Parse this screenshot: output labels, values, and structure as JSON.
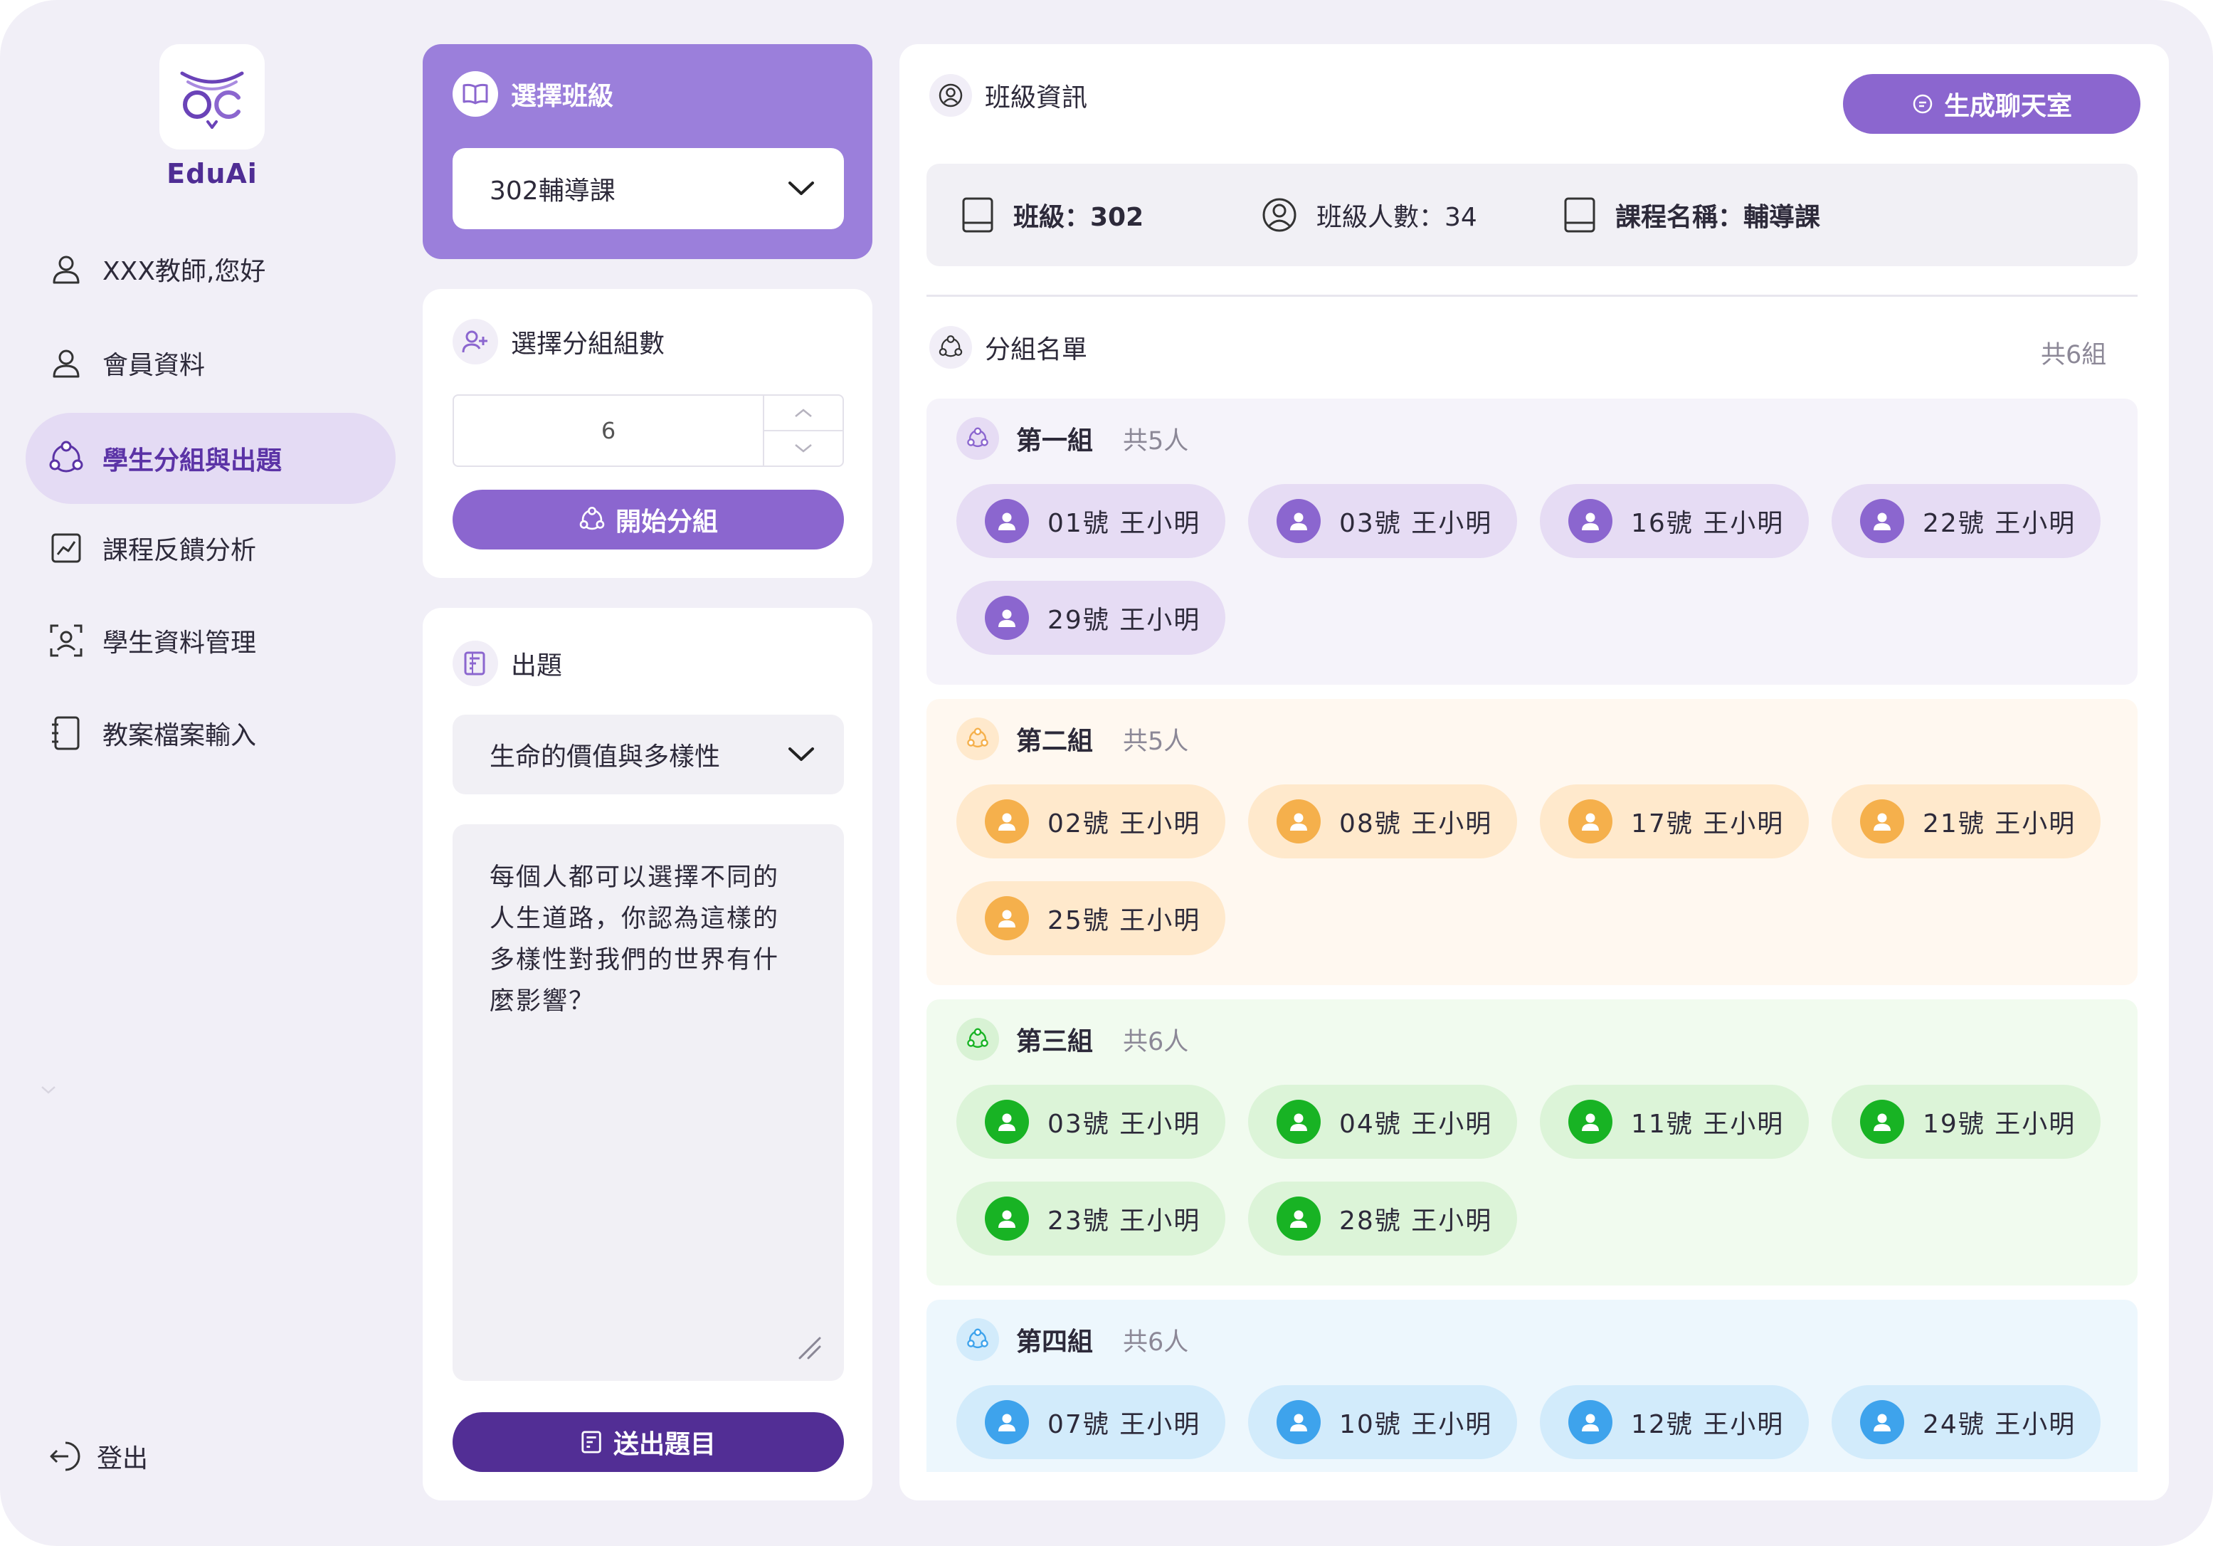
{
  "app": {
    "name": "EduAi"
  },
  "sidebar": {
    "items": [
      {
        "label": "XXX教師,您好"
      },
      {
        "label": "會員資料"
      },
      {
        "label": "學生分組與出題"
      },
      {
        "label": "課程反饋分析"
      },
      {
        "label": "學生資料管理"
      },
      {
        "label": "教案檔案輸入"
      }
    ],
    "logout": "登出"
  },
  "class_select": {
    "title": "選擇班級",
    "value": "302輔導課"
  },
  "group_count": {
    "title": "選擇分組組數",
    "value": "6",
    "button": "開始分組"
  },
  "question": {
    "title": "出題",
    "topic": "生命的價值與多樣性",
    "text_lines": [
      "每個人都可以選擇不同的",
      "人生道路，你認為這樣的",
      "多樣性對我們的世界有什",
      "麼影響？"
    ],
    "submit": "送出題目"
  },
  "class_info": {
    "title": "班級資訊",
    "chat_button": "生成聊天室",
    "class_label": "班級：302",
    "headcount_label": "班級人數：34",
    "course_label": "課程名稱：輔導課"
  },
  "groups_section": {
    "title": "分組名單",
    "total": "共6組",
    "groups": [
      {
        "name": "第一組",
        "count": "共5人",
        "color": "#8b66cf",
        "bg": "#f5f3fa",
        "chip": "#e6dcf4",
        "icon_bg": "#e6dcf4",
        "members": [
          "01號 王小明",
          "03號 王小明",
          "16號 王小明",
          "22號 王小明",
          "29號 王小明"
        ]
      },
      {
        "name": "第二組",
        "count": "共5人",
        "color": "#f5b04c",
        "bg": "#fff8f0",
        "chip": "#ffe9cc",
        "icon_bg": "#ffe9cc",
        "members": [
          "02號 王小明",
          "08號 王小明",
          "17號 王小明",
          "21號 王小明",
          "25號 王小明"
        ]
      },
      {
        "name": "第三組",
        "count": "共6人",
        "color": "#18b324",
        "bg": "#f1fbef",
        "chip": "#dcf4d8",
        "icon_bg": "#d8f2d4",
        "members": [
          "03號 王小明",
          "04號 王小明",
          "11號 王小明",
          "19號 王小明",
          "23號 王小明",
          "28號 王小明"
        ]
      },
      {
        "name": "第四組",
        "count": "共6人",
        "color": "#3ea3ec",
        "bg": "#edf7fd",
        "chip": "#d2ebfb",
        "icon_bg": "#d2ebfb",
        "members": [
          "07號 王小明",
          "10號 王小明",
          "12號 王小明",
          "24號 王小明"
        ]
      }
    ]
  },
  "colors": {
    "accent": "#8b66cf",
    "accent_dark": "#522e95",
    "frame": "#f1eff7"
  }
}
